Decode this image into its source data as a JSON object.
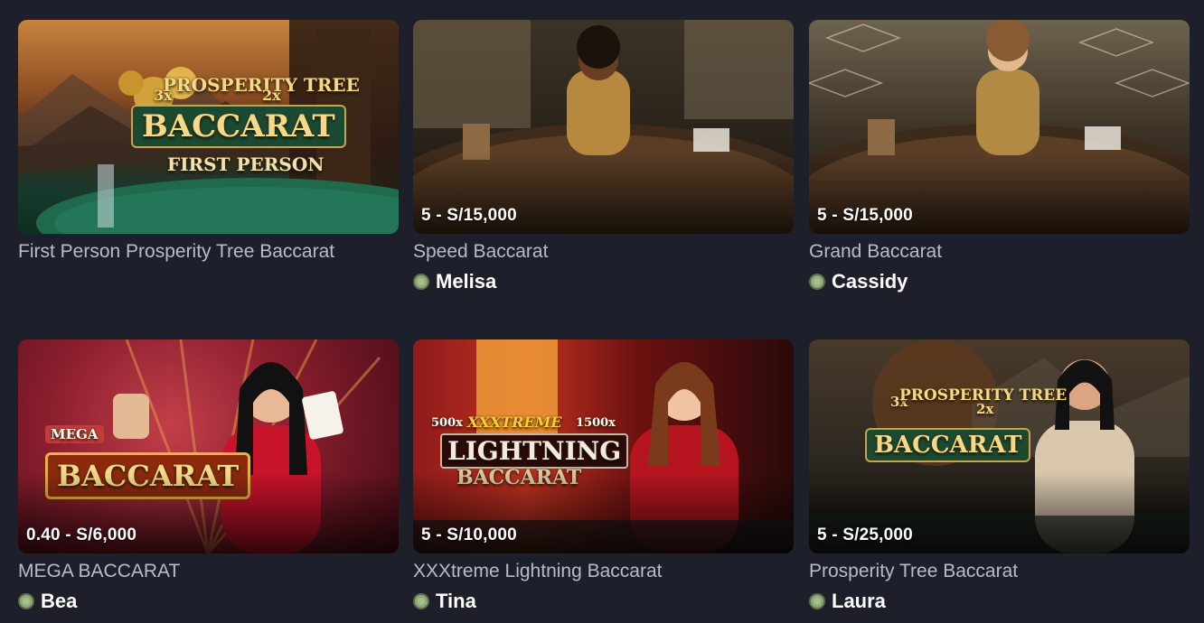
{
  "colors": {
    "background": "#1d1f2a",
    "title_text": "#b9bcc8",
    "dealer_text": "#ffffff",
    "status_dot": "#8fa978"
  },
  "games": [
    {
      "title": "First Person Prosperity Tree Baccarat",
      "limits": "",
      "dealer": "",
      "logo": {
        "top": "3x",
        "name": "PROSPERITY TREE",
        "right": "2x",
        "main": "BACCARAT",
        "sub": "FIRST PERSON"
      }
    },
    {
      "title": "Speed Baccarat",
      "limits": "5 - S/15,000",
      "dealer": "Melisa"
    },
    {
      "title": "Grand Baccarat",
      "limits": "5 - S/15,000",
      "dealer": "Cassidy"
    },
    {
      "title": "MEGA BACCARAT",
      "limits": "0.40 - S/6,000",
      "dealer": "Bea",
      "logo": {
        "badge": "MEGA",
        "main": "BACCARAT"
      }
    },
    {
      "title": "XXXtreme Lightning Baccarat",
      "limits": "5 - S/10,000",
      "dealer": "Tina",
      "logo": {
        "left": "500x",
        "top": "XXXTREME",
        "right": "1500x",
        "main": "LIGHTNING",
        "sub": "BACCARAT"
      }
    },
    {
      "title": "Prosperity Tree Baccarat",
      "limits": "5 - S/25,000",
      "dealer": "Laura",
      "logo": {
        "top": "3x",
        "name": "PROSPERITY TREE",
        "right": "2x",
        "main": "BACCARAT"
      }
    }
  ]
}
